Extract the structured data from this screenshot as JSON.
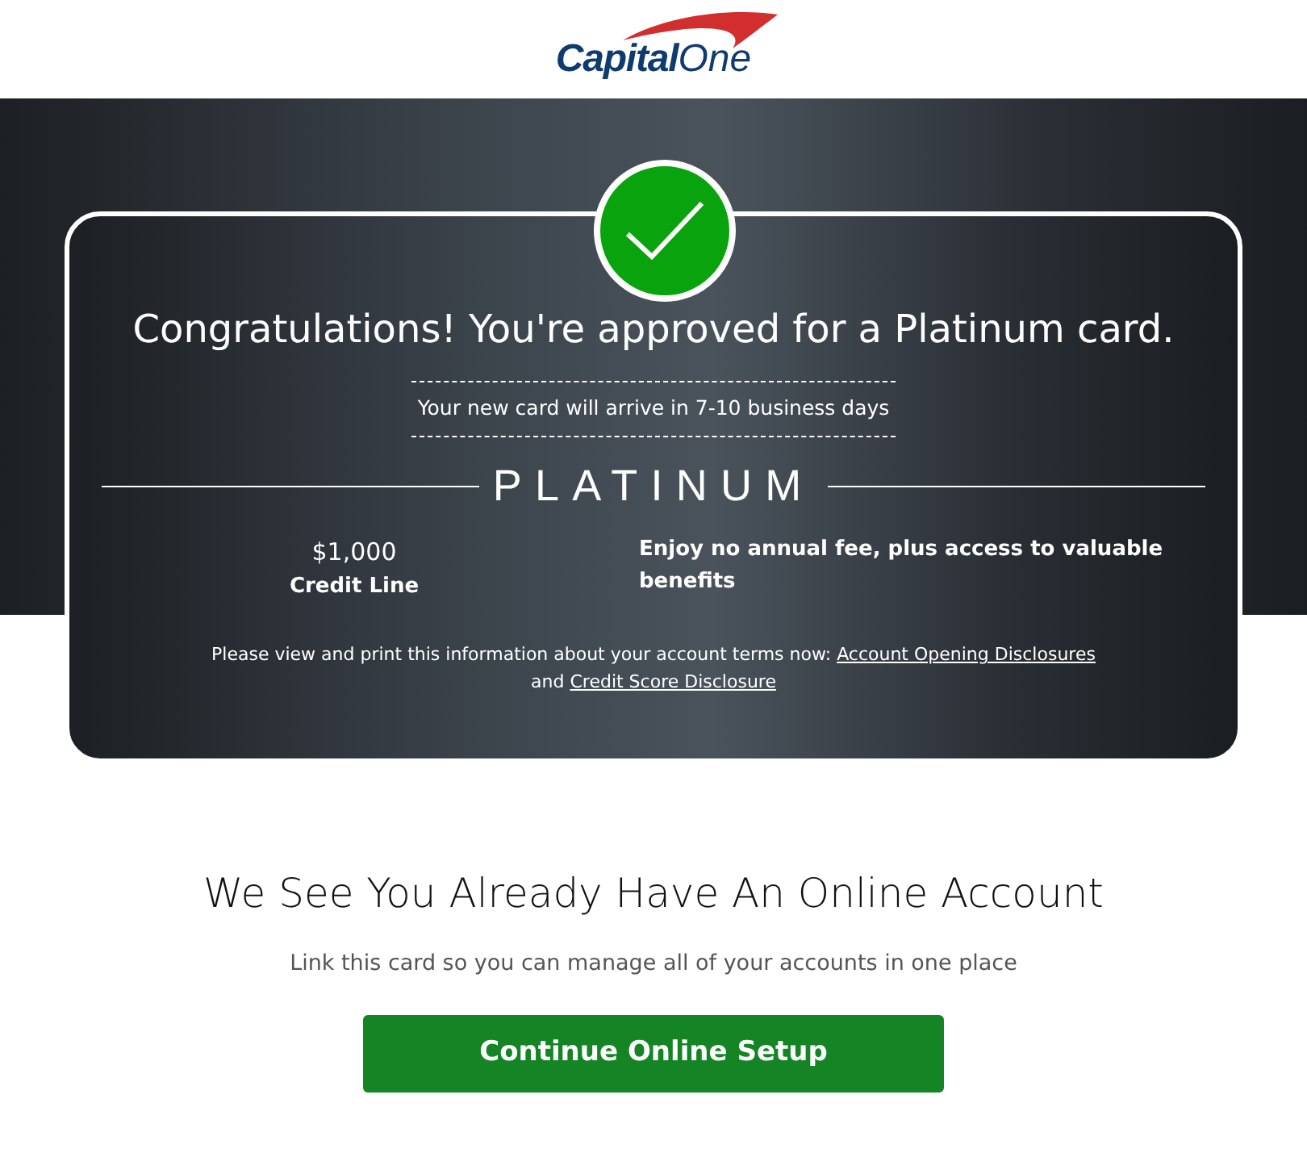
{
  "logo": {
    "word_1": "Capital",
    "word_2": "One"
  },
  "approval": {
    "headline": "Congratulations! You're approved for a Platinum card.",
    "arrival": "Your new card will arrive in 7-10 business days",
    "card_name": "PLATINUM",
    "credit_amount": "$1,000",
    "credit_label": "Credit Line",
    "benefit": "Enjoy no annual fee, plus access to valuable benefits",
    "disclosure": {
      "text": "Please view and print this information about your account terms now:",
      "links": [
        "Account Opening Disclosures",
        "Credit Score Disclosure"
      ],
      "joiner": "and"
    }
  },
  "online_account": {
    "heading": "We See You Already Have An Online Account",
    "subtext": "Link this card so you can manage all of your accounts in one place",
    "button": "Continue Online Setup"
  }
}
